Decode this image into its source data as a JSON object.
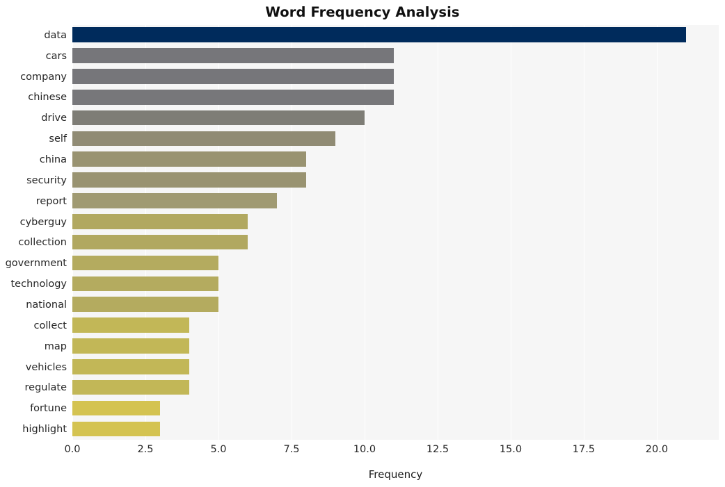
{
  "chart_data": {
    "type": "bar",
    "orientation": "horizontal",
    "title": "Word Frequency Analysis",
    "xlabel": "Frequency",
    "ylabel": "",
    "categories": [
      "data",
      "cars",
      "company",
      "chinese",
      "drive",
      "self",
      "china",
      "security",
      "report",
      "cyberguy",
      "collection",
      "government",
      "technology",
      "national",
      "collect",
      "map",
      "vehicles",
      "regulate",
      "fortune",
      "highlight"
    ],
    "values": [
      21,
      11,
      11,
      11,
      10,
      9,
      8,
      8,
      7,
      6,
      6,
      5,
      5,
      5,
      4,
      4,
      4,
      4,
      3,
      3
    ],
    "bar_colors": [
      "#002b5c",
      "#76767a",
      "#76767a",
      "#77777a",
      "#7e7d76",
      "#908b74",
      "#999371",
      "#999371",
      "#a09a72",
      "#b1a860",
      "#b1a860",
      "#b4ab5f",
      "#b4ab5f",
      "#b4ab5f",
      "#c2b757",
      "#c2b757",
      "#c2b757",
      "#c2b757",
      "#d4c351",
      "#d4c351"
    ],
    "xlim": [
      0,
      22.12
    ],
    "xticks": [
      0.0,
      2.5,
      5.0,
      7.5,
      10.0,
      12.5,
      15.0,
      17.5,
      20.0
    ],
    "xtick_labels": [
      "0.0",
      "2.5",
      "5.0",
      "7.5",
      "10.0",
      "12.5",
      "15.0",
      "17.5",
      "20.0"
    ],
    "grid": true,
    "grid_axis": "x",
    "legend": false,
    "plot_background": "#f6f6f6",
    "figure_background": "#ffffff",
    "colormap": "cividis"
  }
}
